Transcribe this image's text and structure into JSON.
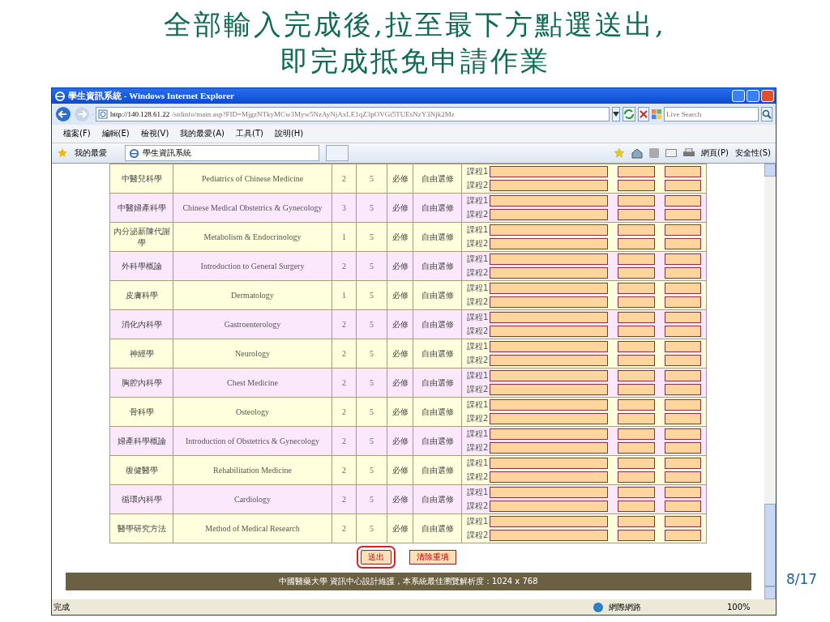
{
  "slide": {
    "title_lines": [
      "全部輸入完成後,拉至最下方點選送出,",
      "即完成抵免申請作業"
    ],
    "page_number": "8/17"
  },
  "window": {
    "title": "學生資訊系統 - Windows Internet Explorer",
    "address_host": "http://140.128.61.22",
    "address_path": "/stdinfo/main.asp?FID=MjgzNTkyMCw3Myw5NzAyNjAxLE1qZ3pOVGt5TUEsNzY3Njk2Mz",
    "search_placeholder": "Live Search",
    "menu": [
      "檔案(F)",
      "編輯(E)",
      "檢視(V)",
      "我的最愛(A)",
      "工具(T)",
      "說明(H)"
    ],
    "favorites": "我的最愛",
    "tab": "學生資訊系統",
    "toolbar": [
      "網頁(P)",
      "安全性(S)"
    ],
    "status": "完成",
    "zone": "網際網路",
    "zoom": "100%"
  },
  "table": {
    "rows": [
      {
        "name_zh": "中醫兒科學",
        "name_en": "Pediatrics of Chinese Medicine",
        "credits": "2",
        "year": "5",
        "type": "必修",
        "elective": "自由選修",
        "slots": [
          "課程1",
          "課程2"
        ]
      },
      {
        "name_zh": "中醫婦產科學",
        "name_en": "Chinese Medical Obstetrics & Gynecology",
        "credits": "3",
        "year": "5",
        "type": "必修",
        "elective": "自由選修",
        "slots": [
          "課程1",
          "課程2"
        ]
      },
      {
        "name_zh": "內分泌新陳代謝學",
        "name_en": "Metabolism & Endocrinology",
        "credits": "1",
        "year": "5",
        "type": "必修",
        "elective": "自由選修",
        "slots": [
          "課程1",
          "課程2"
        ]
      },
      {
        "name_zh": "外科學概論",
        "name_en": "Introduction to General Surgery",
        "credits": "2",
        "year": "5",
        "type": "必修",
        "elective": "自由選修",
        "slots": [
          "課程1",
          "課程2"
        ]
      },
      {
        "name_zh": "皮膚科學",
        "name_en": "Dermatology",
        "credits": "1",
        "year": "5",
        "type": "必修",
        "elective": "自由選修",
        "slots": [
          "課程1",
          "課程2"
        ]
      },
      {
        "name_zh": "消化內科學",
        "name_en": "Gastroenterology",
        "credits": "2",
        "year": "5",
        "type": "必修",
        "elective": "自由選修",
        "slots": [
          "課程1",
          "課程2"
        ]
      },
      {
        "name_zh": "神經學",
        "name_en": "Neurology",
        "credits": "2",
        "year": "5",
        "type": "必修",
        "elective": "自由選修",
        "slots": [
          "課程1",
          "課程2"
        ]
      },
      {
        "name_zh": "胸腔內科學",
        "name_en": "Chest Medicine",
        "credits": "2",
        "year": "5",
        "type": "必修",
        "elective": "自由選修",
        "slots": [
          "課程1",
          "課程2"
        ]
      },
      {
        "name_zh": "骨科學",
        "name_en": "Osteology",
        "credits": "2",
        "year": "5",
        "type": "必修",
        "elective": "自由選修",
        "slots": [
          "課程1",
          "課程2"
        ]
      },
      {
        "name_zh": "婦產科學概論",
        "name_en": "Introduction of Obstetrics & Gynecology",
        "credits": "2",
        "year": "5",
        "type": "必修",
        "elective": "自由選修",
        "slots": [
          "課程1",
          "課程2"
        ]
      },
      {
        "name_zh": "復健醫學",
        "name_en": "Rehabilitation Medicine",
        "credits": "2",
        "year": "5",
        "type": "必修",
        "elective": "自由選修",
        "slots": [
          "課程1",
          "課程2"
        ]
      },
      {
        "name_zh": "循環內科學",
        "name_en": "Cardiology",
        "credits": "2",
        "year": "5",
        "type": "必修",
        "elective": "自由選修",
        "slots": [
          "課程1",
          "課程2"
        ]
      },
      {
        "name_zh": "醫學研究方法",
        "name_en": "Method of Medical Research",
        "credits": "2",
        "year": "5",
        "type": "必修",
        "elective": "自由選修",
        "slots": [
          "課程1",
          "課程2"
        ]
      }
    ]
  },
  "buttons": [
    {
      "label": "送出",
      "circled": true
    },
    {
      "label": "清除重填",
      "circled": false
    }
  ],
  "footer": "中國醫藥大學  資訊中心設計維護，本系統最佳瀏覽解析度：1024 x 768"
}
